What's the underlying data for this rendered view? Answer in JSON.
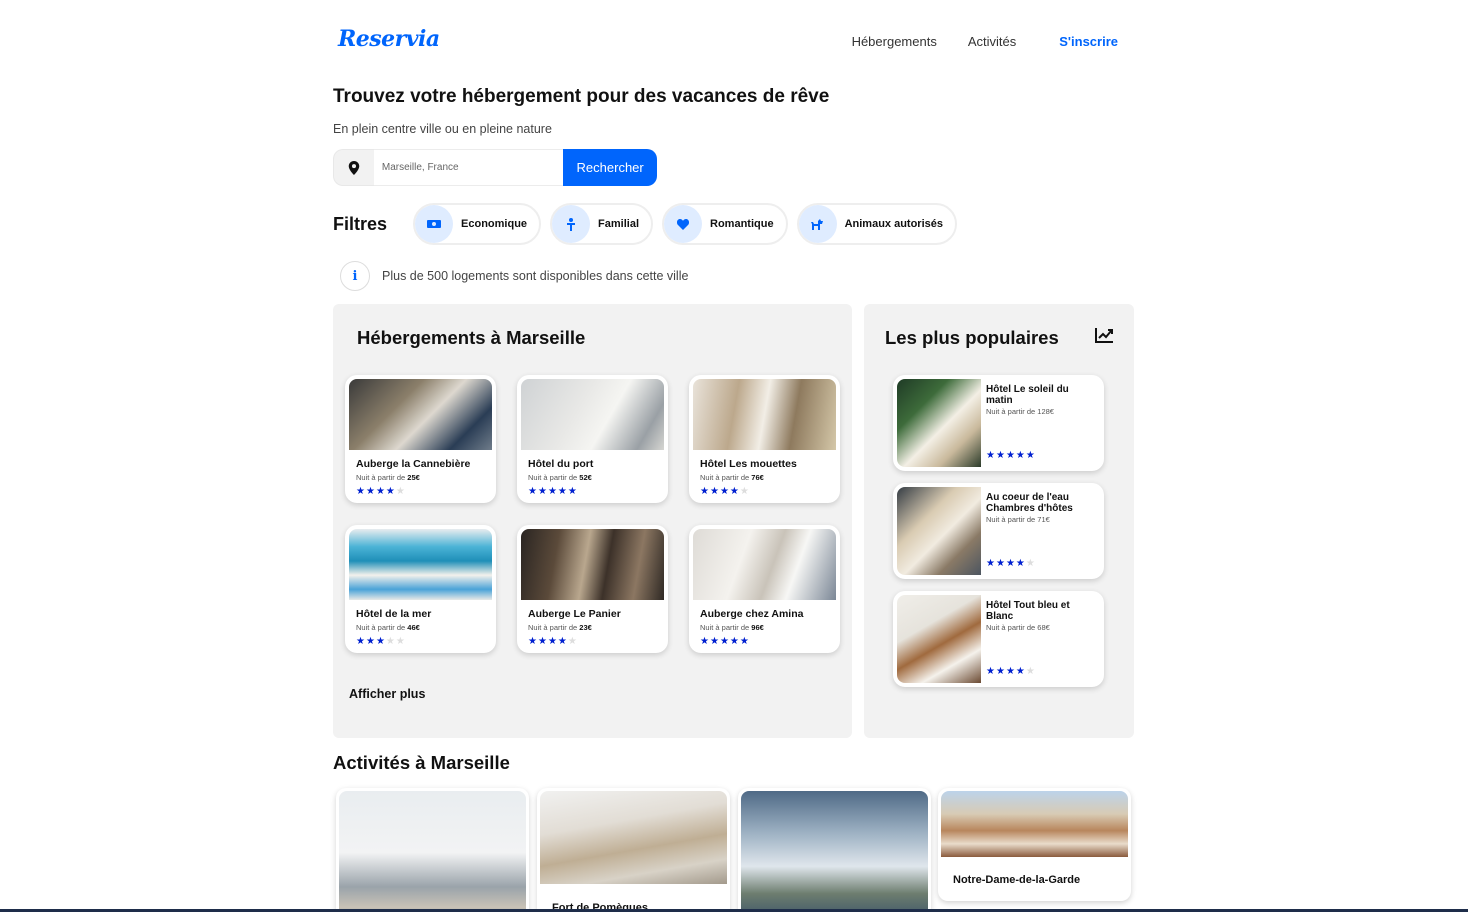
{
  "header": {
    "logo": "Reservia",
    "nav": [
      "Hébergements",
      "Activités"
    ],
    "signup": "S'inscrire"
  },
  "hero": {
    "title": "Trouvez votre hébergement pour des vacances de rêve",
    "subtitle": "En plein centre ville ou en pleine nature"
  },
  "search": {
    "placeholder": "Marseille, France",
    "button": "Rechercher",
    "icon": "location-pin-icon"
  },
  "filters": {
    "title": "Filtres",
    "items": [
      {
        "label": "Economique",
        "icon": "money-icon"
      },
      {
        "label": "Familial",
        "icon": "family-icon"
      },
      {
        "label": "Romantique",
        "icon": "heart-icon"
      },
      {
        "label": "Animaux autorisés",
        "icon": "dog-icon"
      }
    ]
  },
  "info": {
    "icon": "i",
    "text": "Plus de 500 logements sont disponibles dans cette ville"
  },
  "hebergements": {
    "title": "Hébergements à Marseille",
    "price_prefix": "Nuit à partir de ",
    "items": [
      {
        "name": "Auberge la Cannebière",
        "price": "25€",
        "rating": 4
      },
      {
        "name": "Hôtel du port",
        "price": "52€",
        "rating": 5
      },
      {
        "name": "Hôtel Les mouettes",
        "price": "76€",
        "rating": 4
      },
      {
        "name": "Hôtel de la mer",
        "price": "46€",
        "rating": 3
      },
      {
        "name": "Auberge Le Panier",
        "price": "23€",
        "rating": 4
      },
      {
        "name": "Auberge chez Amina",
        "price": "96€",
        "rating": 5
      }
    ],
    "more": "Afficher plus"
  },
  "populaires": {
    "title": "Les plus populaires",
    "icon": "trending-chart-icon",
    "items": [
      {
        "name": "Hôtel Le soleil du matin",
        "price_text": "Nuit à partir de 128€",
        "rating": 5
      },
      {
        "name": "Au coeur de l'eau Chambres d'hôtes",
        "price_text": "Nuit à partir de 71€",
        "rating": 4
      },
      {
        "name": "Hôtel Tout bleu et Blanc",
        "price_text": "Nuit à partir de 68€",
        "rating": 4
      }
    ]
  },
  "activites": {
    "title": "Activités à Marseille",
    "items": [
      {
        "name": ""
      },
      {
        "name": "Fort de Pomègues"
      },
      {
        "name": ""
      },
      {
        "name": "Notre-Dame-de-la-Garde"
      }
    ]
  },
  "colors": {
    "accent": "#0065fc",
    "star": "#0020d0",
    "panel": "#f2f2f2"
  }
}
